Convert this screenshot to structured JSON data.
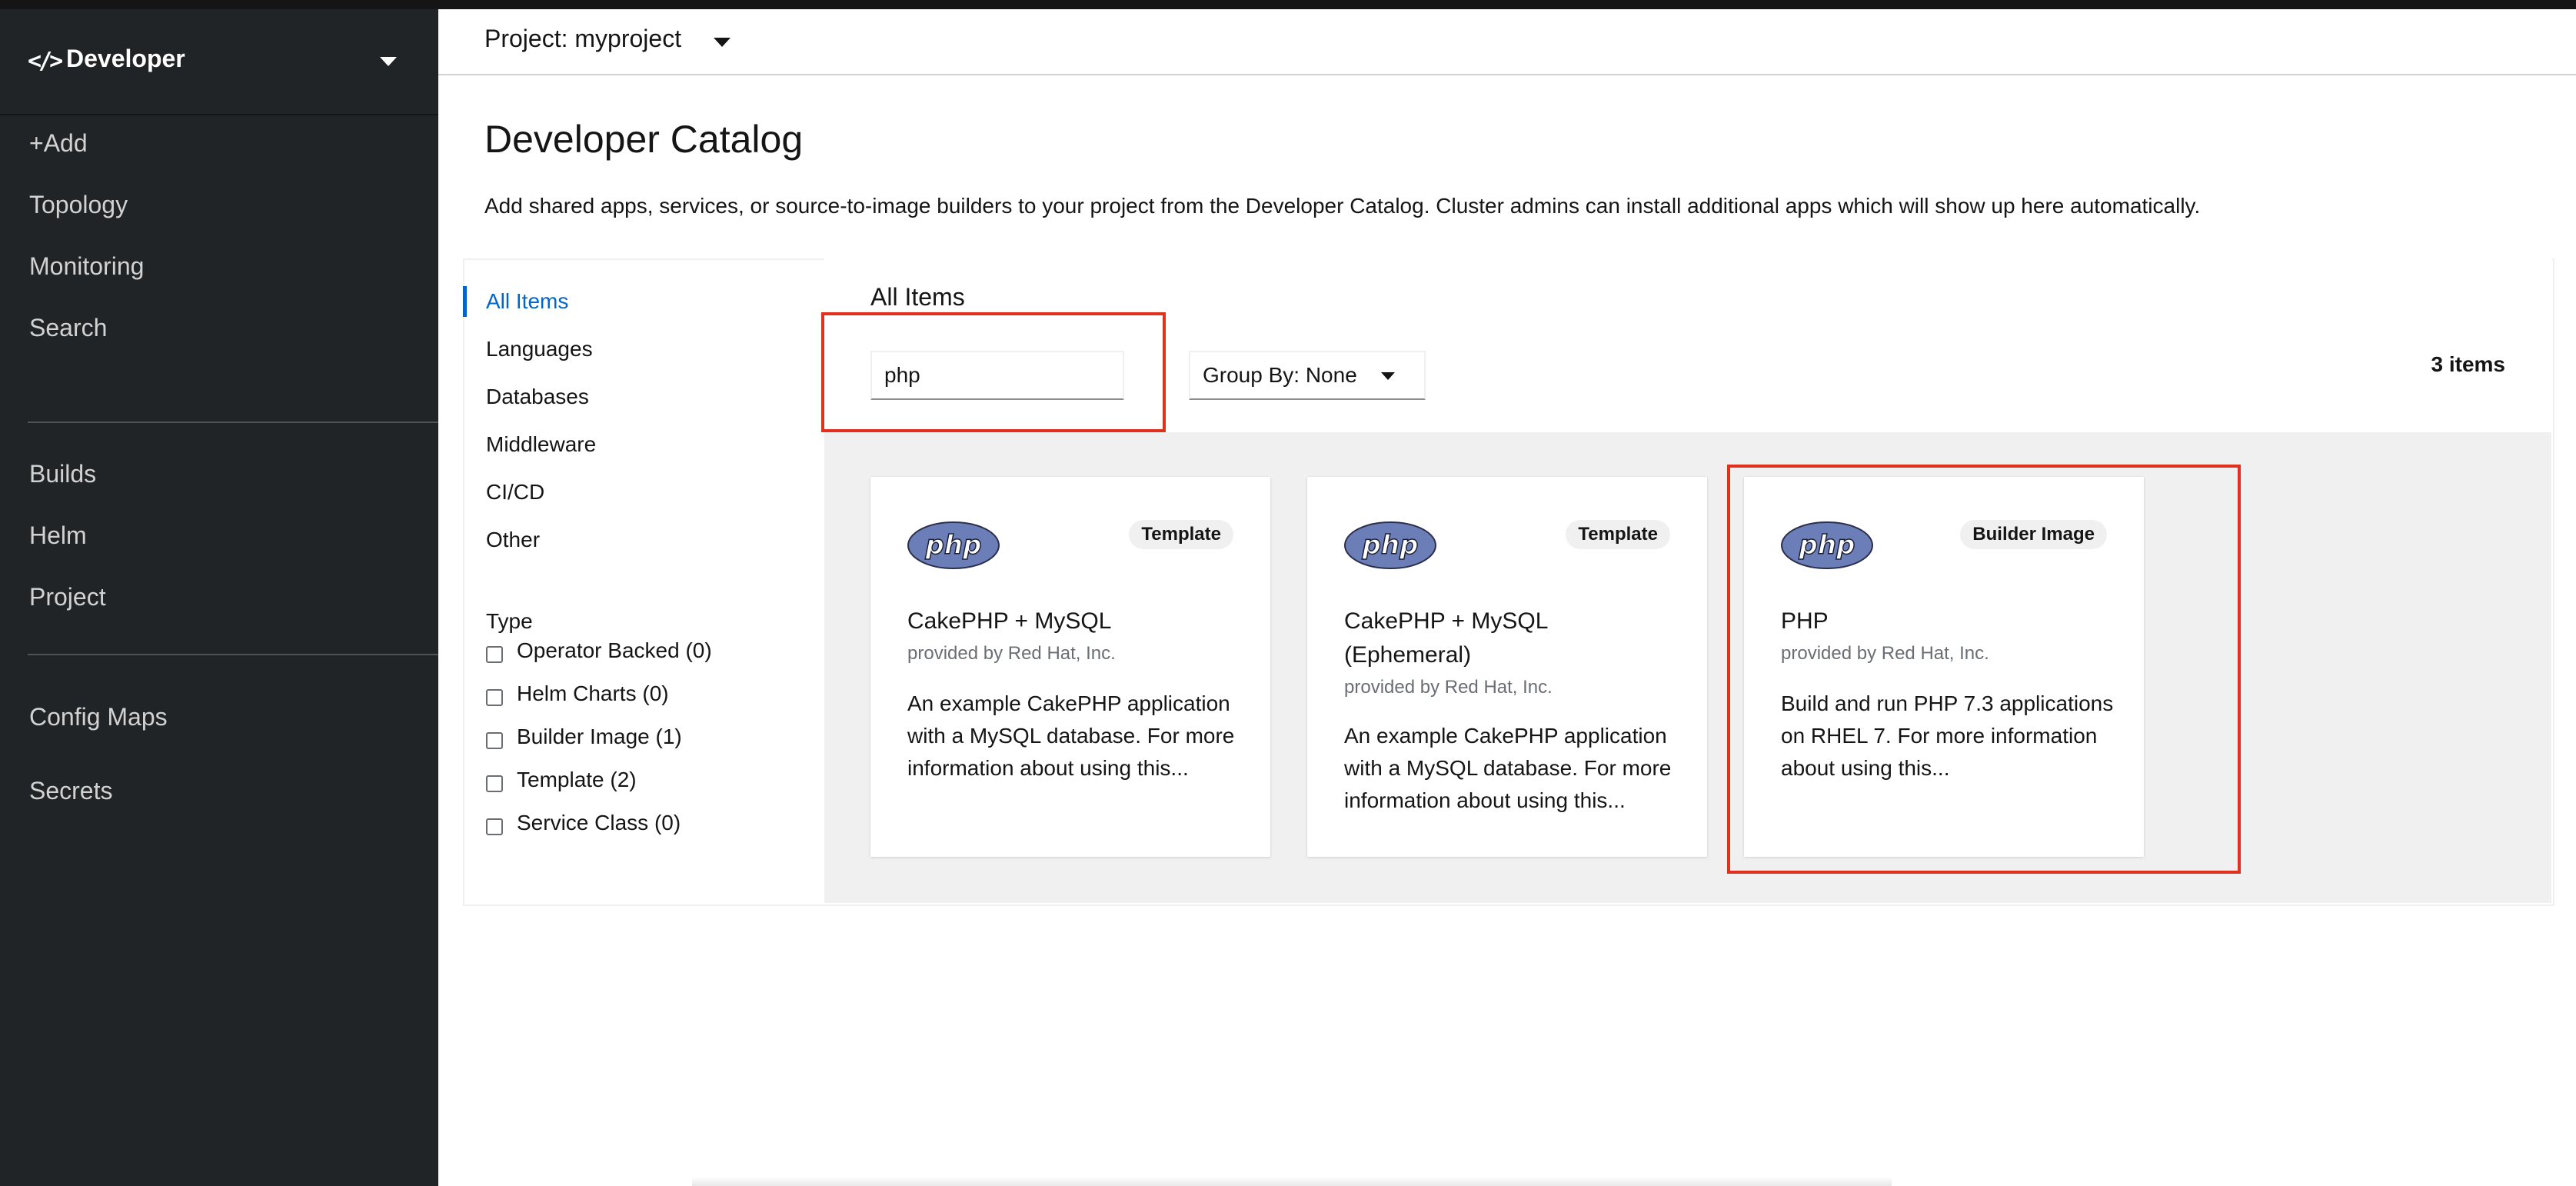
{
  "perspective": {
    "code_glyph": "</>",
    "name": "Developer"
  },
  "nav": {
    "group1": [
      "+Add",
      "Topology",
      "Monitoring",
      "Search"
    ],
    "group2": [
      "Builds",
      "Helm",
      "Project"
    ],
    "group3": [
      "Config Maps",
      "Secrets"
    ]
  },
  "project": {
    "label": "Project: myproject"
  },
  "page": {
    "title": "Developer Catalog",
    "description": "Add shared apps, services, or source-to-image builders to your project from the Developer Catalog. Cluster admins can install additional apps which will show up here automatically."
  },
  "categories": [
    "All Items",
    "Languages",
    "Databases",
    "Middleware",
    "CI/CD",
    "Other"
  ],
  "active_category": "All Items",
  "type_filter": {
    "heading": "Type",
    "options": [
      "Operator Backed (0)",
      "Helm Charts (0)",
      "Builder Image (1)",
      "Template (2)",
      "Service Class (0)"
    ]
  },
  "results": {
    "heading": "All Items",
    "search_value": "php",
    "group_by": "Group By: None",
    "count": "3 items"
  },
  "cards": [
    {
      "logo_text": "php",
      "badge": "Template",
      "title": "CakePHP + MySQL",
      "provider": "provided by Red Hat, Inc.",
      "description": "An example CakePHP application with a MySQL database. For more information about using this..."
    },
    {
      "logo_text": "php",
      "badge": "Template",
      "title": "CakePHP + MySQL (Ephemeral)",
      "provider": "provided by Red Hat, Inc.",
      "description": "An example CakePHP application with a MySQL database. For more information about using this..."
    },
    {
      "logo_text": "php",
      "badge": "Builder Image",
      "title": "PHP",
      "provider": "provided by Red Hat, Inc.",
      "description": "Build and run PHP 7.3 applications on RHEL 7. For more information about using this..."
    }
  ],
  "colors": {
    "sidebar_bg": "#212427",
    "accent_link": "#0066cc",
    "highlight_box": "#e0301e",
    "php_logo": "#6c7eb7"
  }
}
